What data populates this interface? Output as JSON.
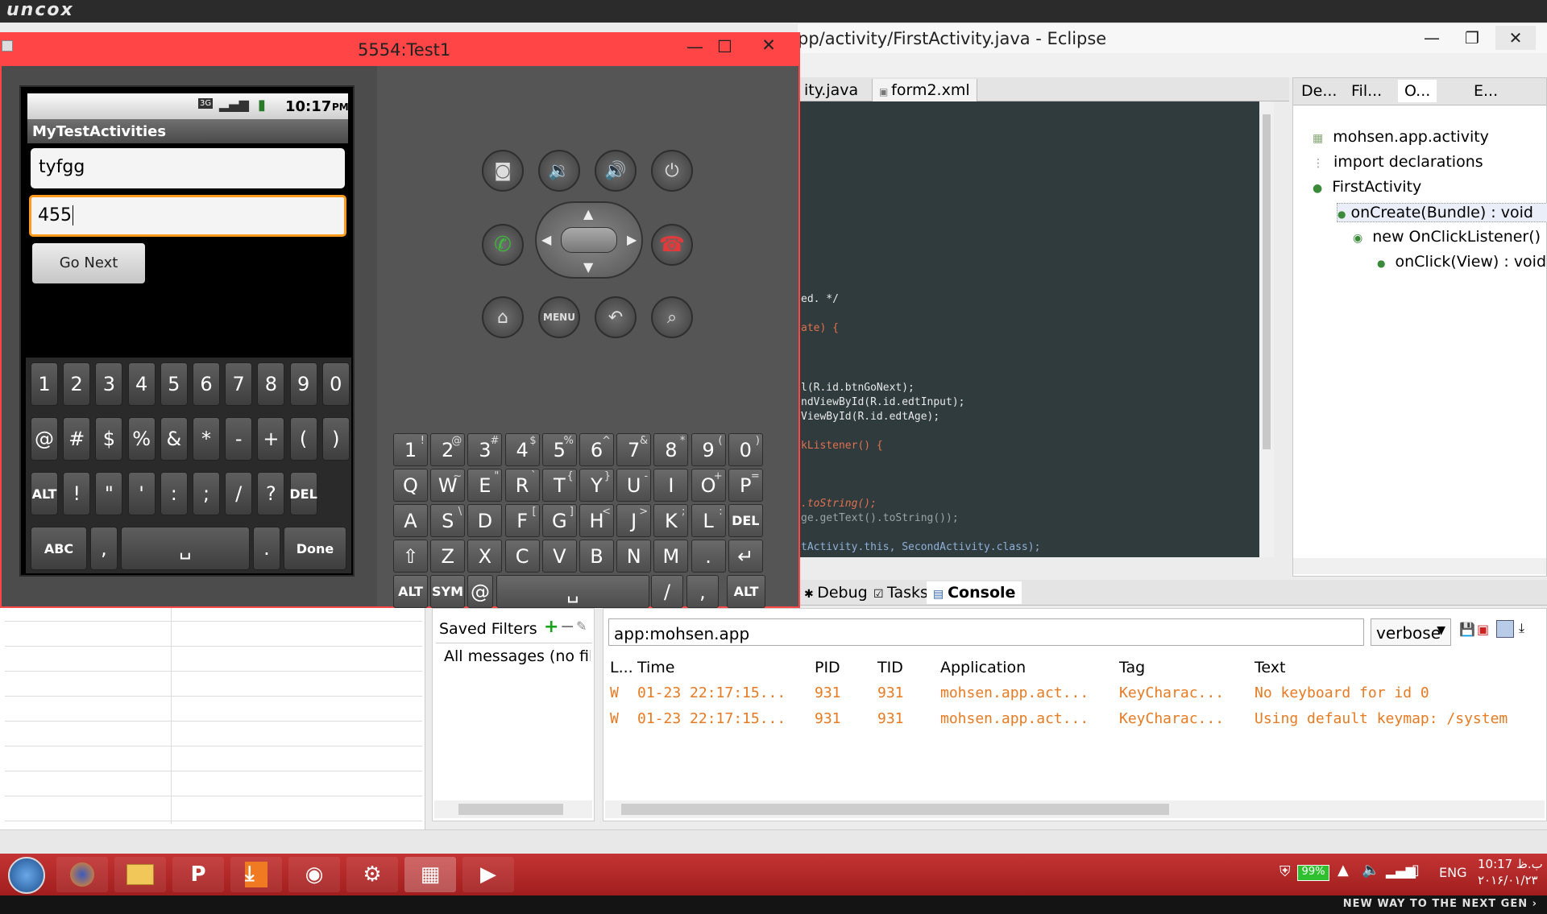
{
  "topbar": {
    "brand": "uncox"
  },
  "eclipse": {
    "title": "pp/activity/FirstActivity.java - Eclipse",
    "tabs": [
      "ity.java",
      "form2.xml"
    ],
    "code": [
      "ed. */",
      "ate) {",
      "l(R.id.btnGoNext);",
      "ndViewById(R.id.edtInput);",
      "ViewById(R.id.edtAge);",
      "kListener() {",
      ".toString();",
      "ge.getText().toString());",
      "tActivity.this, SecondActivity.class);"
    ],
    "outline_tabs": [
      "De...",
      "Fil...",
      "O...",
      "E..."
    ],
    "outline": [
      "mohsen.app.activity",
      "import declarations",
      "FirstActivity",
      "onCreate(Bundle) : void",
      "new OnClickListener() {...",
      "onClick(View) : void"
    ],
    "bottom_tabs": [
      "Debug",
      "Tasks",
      "Console"
    ]
  },
  "logcat": {
    "saved_filters_label": "Saved Filters",
    "filter_item": "All messages (no filte",
    "search": "app:mohsen.app",
    "level": "verbose",
    "columns": [
      "L...",
      "Time",
      "PID",
      "TID",
      "Application",
      "Tag",
      "Text"
    ],
    "rows": [
      [
        "W",
        "01-23 22:17:15...",
        "931",
        "931",
        "mohsen.app.act...",
        "KeyCharac...",
        "No keyboard for id 0"
      ],
      [
        "W",
        "01-23 22:17:15...",
        "931",
        "931",
        "mohsen.app.act...",
        "KeyCharac...",
        "Using default keymap: /system"
      ]
    ]
  },
  "emulator": {
    "title": "5554:Test1",
    "status_time": "10:17",
    "status_ampm": "PM",
    "status_3g": "3G",
    "app_title": "MyTestActivities",
    "input1": "tyfgg",
    "input2": "455",
    "go_next": "Go Next",
    "menu_label": "MENU",
    "soft_rows": [
      [
        "1",
        "2",
        "3",
        "4",
        "5",
        "6",
        "7",
        "8",
        "9",
        "0"
      ],
      [
        "@",
        "#",
        "$",
        "%",
        "&",
        "*",
        "-",
        "+",
        "(",
        ")"
      ],
      [
        "ALT",
        "!",
        "\"",
        "'",
        ":",
        ";",
        "/",
        "?",
        "DEL"
      ]
    ],
    "soft_bottom": [
      "ABC",
      ",",
      "␣",
      ".",
      "Done"
    ],
    "hw_rows": [
      [
        [
          "1",
          "!"
        ],
        [
          "2",
          "@"
        ],
        [
          "3",
          "#"
        ],
        [
          "4",
          "$"
        ],
        [
          "5",
          "%"
        ],
        [
          "6",
          "^"
        ],
        [
          "7",
          "&"
        ],
        [
          "8",
          "*"
        ],
        [
          "9",
          "("
        ],
        [
          "0",
          ")"
        ]
      ],
      [
        [
          "Q",
          ""
        ],
        [
          "W",
          "~"
        ],
        [
          "E",
          "\""
        ],
        [
          "R",
          "`"
        ],
        [
          "T",
          "{"
        ],
        [
          "Y",
          "}"
        ],
        [
          "U",
          "-"
        ],
        [
          "I",
          ""
        ],
        [
          "O",
          "+"
        ],
        [
          "P",
          "="
        ]
      ],
      [
        [
          "A",
          ""
        ],
        [
          "S",
          "\\"
        ],
        [
          "D",
          ""
        ],
        [
          "F",
          "["
        ],
        [
          "G",
          "]"
        ],
        [
          "H",
          "<"
        ],
        [
          "J",
          ">"
        ],
        [
          "K",
          ";"
        ],
        [
          "L",
          ":"
        ],
        [
          "DEL",
          ""
        ]
      ],
      [
        [
          "⇧",
          ""
        ],
        [
          "Z",
          ""
        ],
        [
          "X",
          ""
        ],
        [
          "C",
          ""
        ],
        [
          "V",
          ""
        ],
        [
          "B",
          ""
        ],
        [
          "N",
          ""
        ],
        [
          "M",
          ""
        ],
        [
          ".",
          ""
        ],
        [
          "↵",
          ""
        ]
      ]
    ],
    "hw_bottom": [
      "ALT",
      "SYM",
      "@",
      "␣",
      "/",
      ",",
      "ALT"
    ]
  },
  "taskbar": {
    "battery": "99%",
    "lang": "ENG",
    "time": "10:17 ب.ظ",
    "date": "۲۰۱۶/۰۱/۲۳"
  },
  "footer": {
    "text": "NEW WAY TO THE NEXT GEN ›"
  }
}
